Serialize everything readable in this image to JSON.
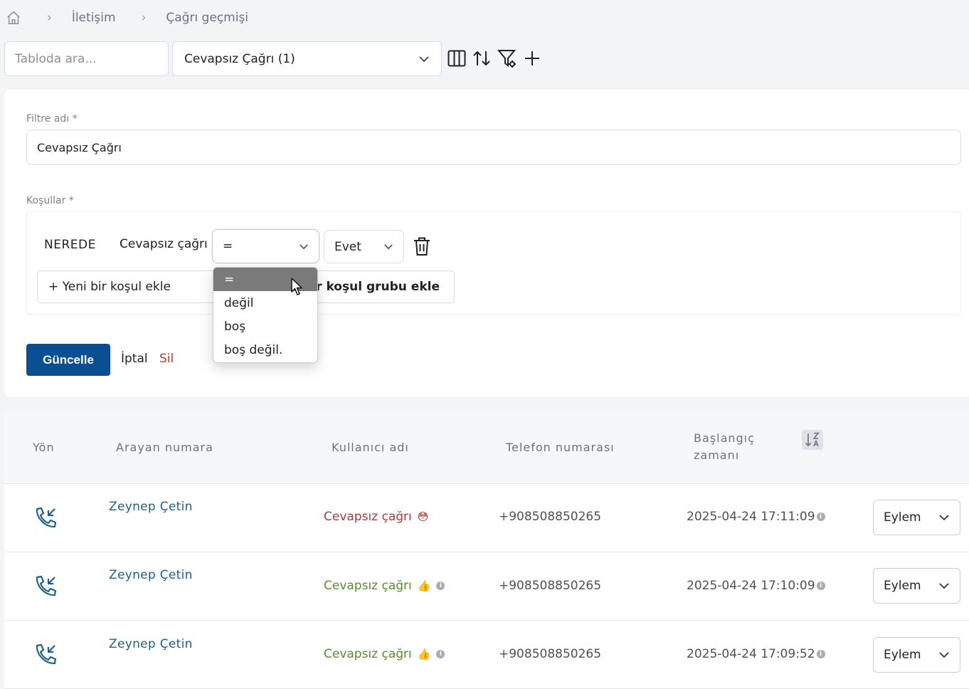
{
  "breadcrumb": {
    "items": [
      "İletişim",
      "Çağrı geçmişi"
    ]
  },
  "toolbar": {
    "search_placeholder": "Tabloda ara...",
    "selected_filter": "Cevapsız Çağrı (1)",
    "icons": [
      "columns-icon",
      "sort-icon",
      "filter-settings-icon",
      "plus-icon"
    ]
  },
  "filter_form": {
    "name_label": "Filtre adı *",
    "name_value": "Cevapsız Çağrı",
    "conditions_label": "Koşullar *",
    "condition": {
      "where_label": "NEREDE",
      "field": "Cevapsız çağrı",
      "operator": "=",
      "value": "Evet"
    },
    "operator_options": [
      "=",
      "değil",
      "boş",
      "boş değil."
    ],
    "add_condition_label": "+ Yeni bir koşul ekle",
    "add_group_label": "bir koşul grubu ekle",
    "update_label": "Güncelle",
    "cancel_label": "İptal",
    "delete_label": "Sil"
  },
  "table": {
    "headers": {
      "direction": "Yön",
      "caller": "Arayan numara",
      "username": "Kullanıcı adı",
      "phone": "Telefon numarası",
      "start_line1": "Başlangıç",
      "start_line2": "zamanı"
    },
    "rows": [
      {
        "caller": "Zeynep Çetin",
        "status": "Cevapsız çağrı",
        "emoji": "😳",
        "phone": "+908508850265",
        "start": "2025-04-24 17:11:09",
        "action": "Eylem"
      },
      {
        "caller": "Zeynep Çetin",
        "status": "Cevapsız çağrı",
        "emoji": "👍",
        "phone": "+908508850265",
        "start": "2025-04-24 17:10:09",
        "action": "Eylem"
      },
      {
        "caller": "Zeynep Çetin",
        "status": "Cevapsız çağrı",
        "emoji": "👍",
        "phone": "+908508850265",
        "start": "2025-04-24 17:09:52",
        "action": "Eylem"
      }
    ]
  },
  "colors": {
    "primary": "#0b4f93",
    "danger": "#c0392b",
    "status_red": "#b03a3a",
    "status_green": "#5c8a2a",
    "link": "#1f5f8b"
  }
}
